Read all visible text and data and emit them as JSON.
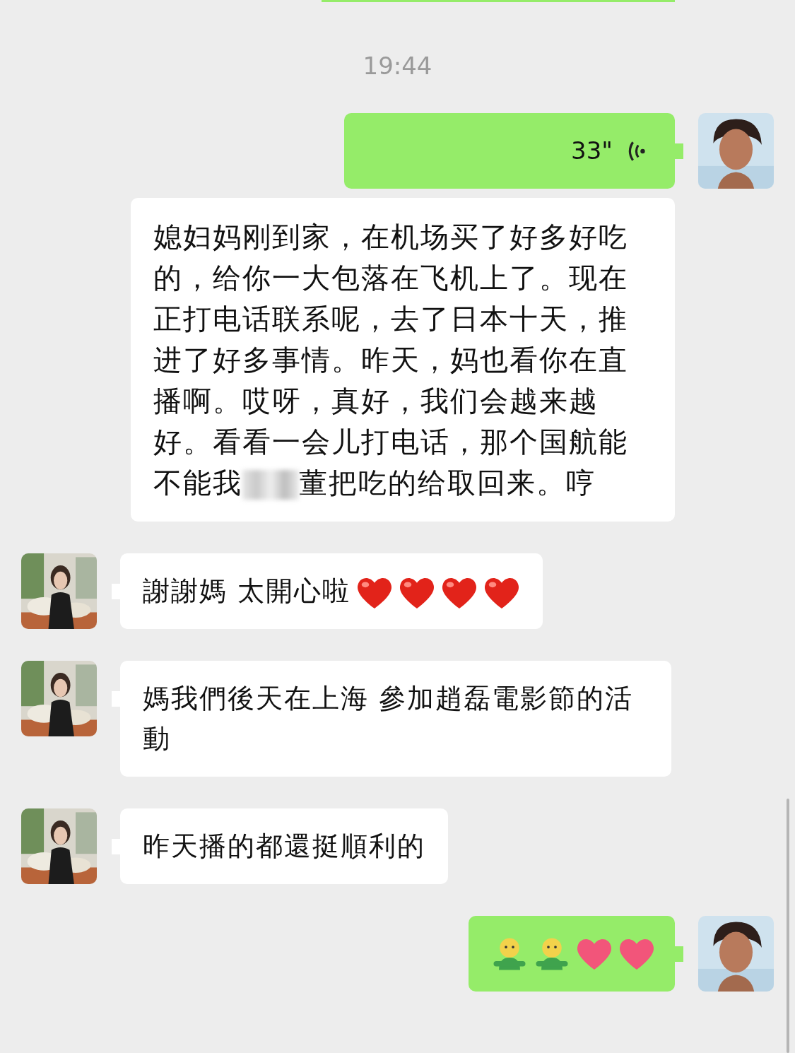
{
  "messages": [
    {
      "outgoing": true,
      "kind": "clipped"
    },
    {
      "kind": "time",
      "text": "19:44"
    },
    {
      "outgoing": true,
      "kind": "voice",
      "duration": "33\"",
      "transcript": {
        "before": "媳妇妈刚到家，在机场买了好多好吃的，给你一大包落在飞机上了。现在正打电话联系呢，去了日本十天，推进了好多事情。昨天，妈也看你在直播啊。哎呀，真好，我们会越来越好。看看一会儿打电话，那个国航能不能我",
        "redacted": true,
        "after": "董把吃的给取回来。哼"
      }
    },
    {
      "outgoing": false,
      "kind": "text",
      "text": "謝謝媽 太開心啦",
      "emojis": [
        {
          "kind": "heart"
        },
        {
          "kind": "heart"
        },
        {
          "kind": "heart"
        },
        {
          "kind": "heart"
        }
      ]
    },
    {
      "outgoing": false,
      "kind": "text",
      "text": "媽我們後天在上海 參加趙磊電影節的活動"
    },
    {
      "outgoing": false,
      "kind": "text",
      "text": "昨天播的都還挺順利的"
    },
    {
      "outgoing": true,
      "kind": "emoji",
      "emojis": [
        {
          "kind": "figure"
        },
        {
          "kind": "figure"
        },
        {
          "kind": "pinkheart"
        },
        {
          "kind": "pinkheart"
        }
      ]
    }
  ]
}
